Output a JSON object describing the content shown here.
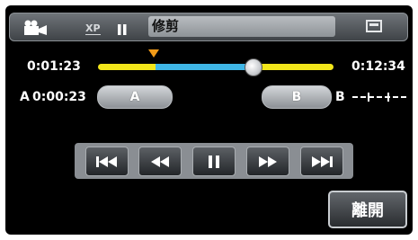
{
  "top_bar": {
    "quality_label": "XP",
    "title": "修剪"
  },
  "playback": {
    "current_time": "0:01:23",
    "total_time": "0:12:34",
    "position_fraction": 0.66
  },
  "ab": {
    "a_marker_label": "A",
    "a_time": "0:00:23",
    "a_button_label": "A",
    "b_button_label": "B",
    "b_marker_label": "B"
  },
  "controls": [
    "skip-back",
    "rewind",
    "pause",
    "fast-forward",
    "skip-forward"
  ],
  "close_label": "離開",
  "colors": {
    "track_yellow": "#f2e61a",
    "track_blue": "#3fb6e6",
    "marker_orange": "#f29b18"
  }
}
